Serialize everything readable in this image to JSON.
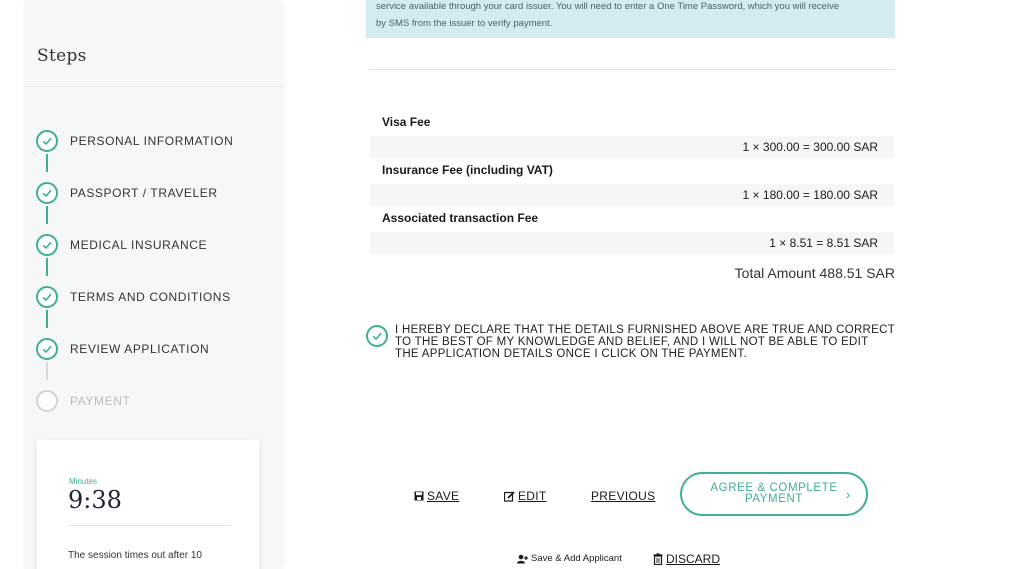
{
  "sidebar": {
    "title": "Steps",
    "steps": [
      {
        "label": "PERSONAL INFORMATION",
        "status": "complete"
      },
      {
        "label": "PASSPORT / TRAVELER",
        "status": "complete"
      },
      {
        "label": "MEDICAL INSURANCE",
        "status": "complete"
      },
      {
        "label": "TERMS AND CONDITIONS",
        "status": "complete"
      },
      {
        "label": "REVIEW APPLICATION",
        "status": "complete"
      },
      {
        "label": "PAYMENT",
        "status": "pending"
      }
    ],
    "timer": {
      "label": "Minutes",
      "value": "9:38",
      "note": "The session times out after 10"
    }
  },
  "banner": {
    "line1": "service available through your card issuer. You will need to enter a One Time Password, which you will receive",
    "line2": "by SMS from the issuer to verify payment."
  },
  "fees": [
    {
      "title": "Visa Fee",
      "value": "1 × 300.00 = 300.00 SAR"
    },
    {
      "title": "Insurance Fee (including VAT)",
      "value": "1 × 180.00 = 180.00 SAR"
    },
    {
      "title": "Associated transaction Fee",
      "value": "1 × 8.51 = 8.51 SAR"
    }
  ],
  "total": "Total Amount 488.51 SAR",
  "declaration": "I HEREBY DECLARE THAT THE DETAILS FURNISHED ABOVE ARE TRUE AND CORRECT TO THE BEST OF MY KNOWLEDGE AND BELIEF, AND I WILL NOT BE ABLE TO EDIT THE APPLICATION DETAILS ONCE I CLICK ON THE PAYMENT.",
  "actions": {
    "save": "SAVE",
    "edit": "EDIT",
    "previous": "PREVIOUS",
    "agree": "AGREE & COMPLETE PAYMENT",
    "save_add": "Save & Add Applicant",
    "discard": "DISCARD"
  },
  "colors": {
    "accent": "#3fae95",
    "banner_bg": "#d3ecef"
  }
}
